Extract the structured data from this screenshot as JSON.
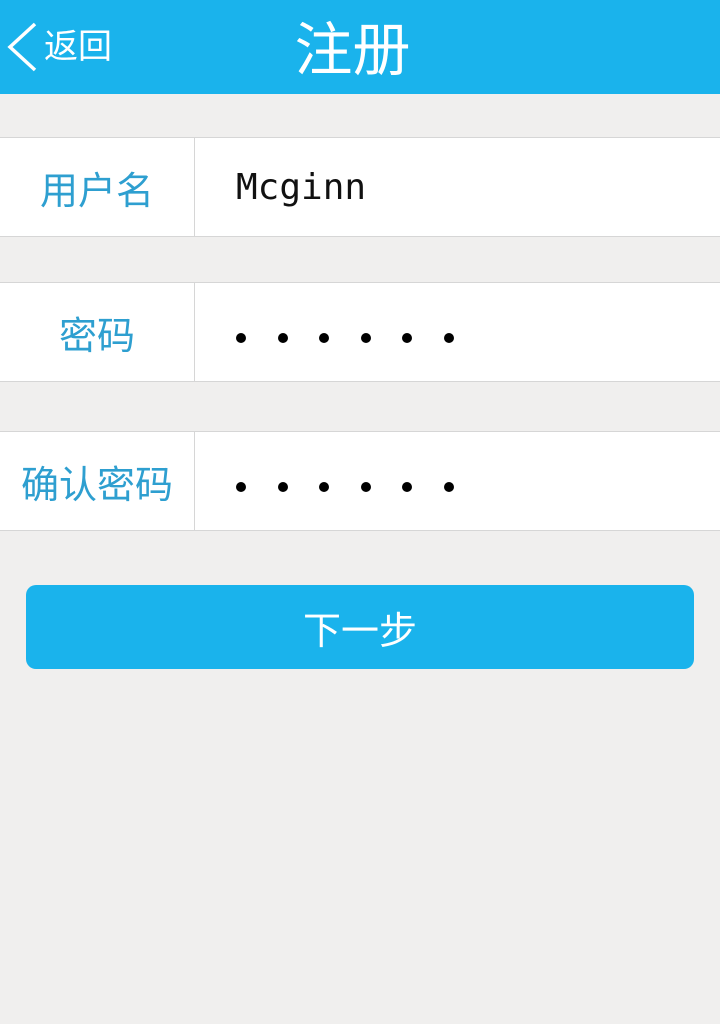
{
  "header": {
    "back_label": "返回",
    "title": "注册"
  },
  "form": {
    "username": {
      "label": "用户名",
      "value": "Mcginn"
    },
    "password": {
      "label": "密码",
      "masked_length": 6
    },
    "confirm_password": {
      "label": "确认密码",
      "masked_length": 6
    }
  },
  "actions": {
    "next_label": "下一步"
  },
  "colors": {
    "primary": "#1ab3ec",
    "label_text": "#2e9fd0",
    "page_background": "#f0efee",
    "divider": "#d6d6d6"
  },
  "icons": {
    "back": "chevron-left-icon"
  }
}
